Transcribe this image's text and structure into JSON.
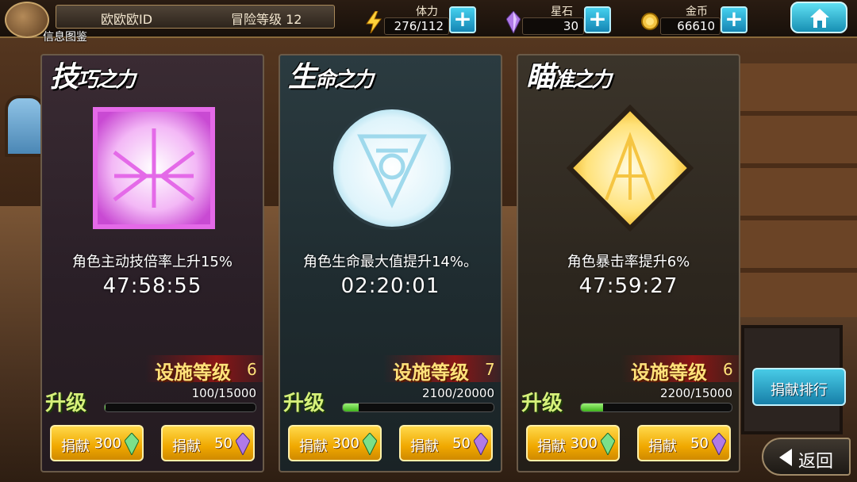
{
  "header": {
    "player_name": "欧欧欧ID",
    "level_text": "冒险等级  12",
    "info_label": "信息图鉴",
    "resources": [
      {
        "title": "体力",
        "value": "276/112",
        "icon": "lightning-icon"
      },
      {
        "title": "星石",
        "value": "30",
        "icon": "star-stone-icon"
      },
      {
        "title": "金币",
        "value": "66610",
        "icon": "gold-coin-icon"
      }
    ],
    "plus_label": "+"
  },
  "panels": [
    {
      "title_big": "技",
      "title_rest": "巧之力",
      "description": "角色主动技倍率上升15%",
      "timer": "47:58:55",
      "facility_label": "设施等级",
      "facility_level": "6",
      "upgrade_label": "升级",
      "exp_text": "100/15000",
      "exp_fraction": 0.007,
      "donate_label": "捐献",
      "donate_amount_1": "300",
      "donate_amount_2": "50",
      "accent": "#e46ae8"
    },
    {
      "title_big": "生",
      "title_rest": "命之力",
      "description": "角色生命最大值提升14%。",
      "timer": "02:20:01",
      "facility_label": "设施等级",
      "facility_level": "7",
      "upgrade_label": "升级",
      "exp_text": "2100/20000",
      "exp_fraction": 0.105,
      "donate_label": "捐献",
      "donate_amount_1": "300",
      "donate_amount_2": "50",
      "accent": "#bfe9f5"
    },
    {
      "title_big": "瞄",
      "title_rest": "准之力",
      "description": "角色暴击率提升6%",
      "timer": "47:59:27",
      "facility_label": "设施等级",
      "facility_level": "6",
      "upgrade_label": "升级",
      "exp_text": "2200/15000",
      "exp_fraction": 0.147,
      "donate_label": "捐献",
      "donate_amount_1": "300",
      "donate_amount_2": "50",
      "accent": "#ffd34a"
    }
  ],
  "side": {
    "rank_label": "捐献排行",
    "back_label": "返回"
  }
}
